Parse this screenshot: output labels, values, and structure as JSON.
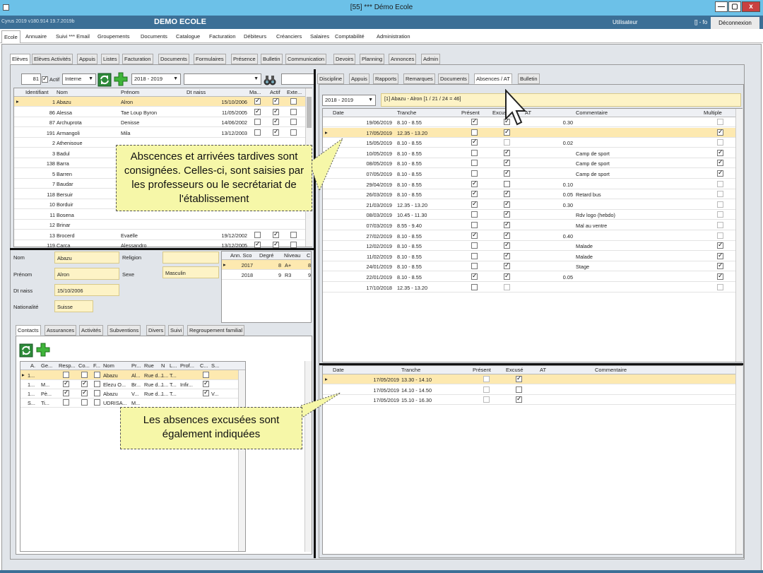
{
  "window": {
    "title": "[55] *** Démo Ecole",
    "minimize": "—",
    "maximize": "▢",
    "close": "x"
  },
  "appbar": {
    "version": "Cyrus 2019 v180.914 19.7.2019b",
    "school": "DEMO ECOLE",
    "user": "Utilisateur",
    "user_extra": "[] - fo",
    "logout": "Déconnexion"
  },
  "menu": [
    "Ecole",
    "Annuaire",
    "Suivi *** Email",
    "Groupements",
    "Documents",
    "Catalogue",
    "Facturation",
    "Débiteurs",
    "Créanciers",
    "Salaires",
    "Comptabilité",
    "Administration"
  ],
  "subtabs": [
    "Elèves",
    "Elèves Activités",
    "Appuis",
    "Listes",
    "Facturation",
    "Documents",
    "Formulaires",
    "Présence",
    "Bulletin",
    "Communication",
    "Devoirs",
    "Planning",
    "Annonces",
    "Admin"
  ],
  "filter": {
    "count": "81",
    "actif_label": "Actif",
    "type": "Interne",
    "year": "2018 - 2019"
  },
  "students": {
    "columns": [
      "Identifiant",
      "Nom",
      "Prénom",
      "Dt naiss",
      "Ma...",
      "Actif",
      "Exte..."
    ],
    "rows": [
      {
        "id": "1",
        "nom": "Abazu",
        "prenom": "Alron",
        "dt": "15/10/2006",
        "ma": true,
        "actif": true,
        "ext": false
      },
      {
        "id": "86",
        "nom": "Alessa",
        "prenom": "Tae Loup Byron",
        "dt": "11/05/2005",
        "ma": true,
        "actif": true,
        "ext": false
      },
      {
        "id": "87",
        "nom": "Archuprota",
        "prenom": "Denisse",
        "dt": "14/06/2002",
        "ma": false,
        "actif": true,
        "ext": false
      },
      {
        "id": "191",
        "nom": "Armangoli",
        "prenom": "Mila",
        "dt": "13/12/2003",
        "ma": false,
        "actif": true,
        "ext": false
      },
      {
        "id": "2",
        "nom": "Athenisoue",
        "prenom": "",
        "dt": "",
        "ma": false,
        "actif": false,
        "ext": false
      },
      {
        "id": "3",
        "nom": "Badul",
        "prenom": "",
        "dt": "",
        "ma": false,
        "actif": false,
        "ext": false
      },
      {
        "id": "138",
        "nom": "Barra",
        "prenom": "",
        "dt": "",
        "ma": false,
        "actif": false,
        "ext": false
      },
      {
        "id": "5",
        "nom": "Barren",
        "prenom": "",
        "dt": "",
        "ma": false,
        "actif": false,
        "ext": false
      },
      {
        "id": "7",
        "nom": "Baudar",
        "prenom": "",
        "dt": "",
        "ma": false,
        "actif": false,
        "ext": false
      },
      {
        "id": "118",
        "nom": "Bersuir",
        "prenom": "",
        "dt": "",
        "ma": false,
        "actif": false,
        "ext": false
      },
      {
        "id": "10",
        "nom": "Borduir",
        "prenom": "",
        "dt": "",
        "ma": false,
        "actif": false,
        "ext": false
      },
      {
        "id": "11",
        "nom": "Bosena",
        "prenom": "",
        "dt": "",
        "ma": false,
        "actif": false,
        "ext": false
      },
      {
        "id": "12",
        "nom": "Brinar",
        "prenom": "",
        "dt": "",
        "ma": false,
        "actif": false,
        "ext": false
      },
      {
        "id": "13",
        "nom": "Brocerd",
        "prenom": "Evaëlle",
        "dt": "19/12/2002",
        "ma": false,
        "actif": true,
        "ext": false
      },
      {
        "id": "119",
        "nom": "Carca",
        "prenom": "Alessandro",
        "dt": "13/12/2005",
        "ma": true,
        "actif": true,
        "ext": false
      }
    ]
  },
  "detail": {
    "nom_label": "Nom",
    "nom": "Abazu",
    "religion_label": "Religion",
    "prenom_label": "Prénom",
    "prenom": "Alron",
    "sexe_label": "Sexe",
    "sexe": "Masculin",
    "dtnaiss_label": "Dt naiss",
    "dtnaiss": "15/10/2006",
    "nat_label": "Nationalité",
    "nat": "Suisse",
    "years_columns": [
      "Ann. Sco",
      "Degré",
      "Niveau",
      "C"
    ],
    "years": [
      {
        "an": "2017",
        "deg": "8",
        "niv": "A+",
        "c": "8"
      },
      {
        "an": "2018",
        "deg": "9",
        "niv": "R3",
        "c": "9"
      }
    ]
  },
  "contact_tabs": [
    "Contacts",
    "Assurances",
    "Activités",
    "Subventions",
    "Divers",
    "Suivi",
    "Regroupement familial"
  ],
  "contacts": {
    "columns": [
      "A.",
      "Ge...",
      "Resp...",
      "Co...",
      "F...",
      "Nom",
      "Pr...",
      "Rue",
      "N",
      "L...",
      "Prof...",
      "C...",
      "S..."
    ],
    "rows": [
      {
        "a": "1...",
        "ge": "",
        "resp": false,
        "co": false,
        "f": false,
        "nom": "Abazu",
        "pr": "Al...",
        "rue": "Rue d...",
        "n": "1...",
        "l": "T...",
        "prof": "",
        "c": false,
        "s": ""
      },
      {
        "a": "1...",
        "ge": "M...",
        "resp": true,
        "co": true,
        "f": false,
        "nom": "Elezu O...",
        "pr": "Br...",
        "rue": "Rue d...",
        "n": "1...",
        "l": "T...",
        "prof": "Infir...",
        "c": true,
        "s": ""
      },
      {
        "a": "1...",
        "ge": "Pè...",
        "resp": true,
        "co": true,
        "f": false,
        "nom": "Abazu",
        "pr": "V...",
        "rue": "Rue d...",
        "n": "1...",
        "l": "T...",
        "prof": "",
        "c": true,
        "s": "V..."
      },
      {
        "a": "S...",
        "ge": "Ti...",
        "resp": false,
        "co": false,
        "f": false,
        "nom": "UDRISA...",
        "pr": "M...",
        "rue": "",
        "n": "",
        "l": "",
        "prof": "",
        "c": false,
        "s": ""
      }
    ]
  },
  "right_tabs": [
    "Discipline",
    "Appuis",
    "Rapports",
    "Remarques",
    "Documents",
    "Absences / AT",
    "Bulletin"
  ],
  "absences": {
    "year": "2018 - 2019",
    "summary": "[1] Abazu - Alron [1 / 21 / 24 = 46]",
    "columns": [
      "Date",
      "Tranche",
      "Présent",
      "Excusé",
      "AT",
      "Commentaire",
      "Multiple"
    ],
    "rows": [
      {
        "date": "19/06/2019",
        "tranche": "8.10 - 8.55",
        "present": true,
        "excuse": true,
        "at": "0.30",
        "comment": "",
        "multiple": false
      },
      {
        "date": "17/05/2019",
        "tranche": "12.35 - 13.20",
        "present": false,
        "excuse": true,
        "at": "",
        "comment": "",
        "multiple": true
      },
      {
        "date": "15/05/2019",
        "tranche": "8.10 - 8.55",
        "present": true,
        "excuse": false,
        "at": "0.02",
        "comment": "",
        "multiple": false
      },
      {
        "date": "10/05/2019",
        "tranche": "8.10 - 8.55",
        "present": false,
        "excuse": true,
        "at": "",
        "comment": "Camp de sport",
        "multiple": true
      },
      {
        "date": "08/05/2019",
        "tranche": "8.10 - 8.55",
        "present": false,
        "excuse": true,
        "at": "",
        "comment": "Camp de sport",
        "multiple": true
      },
      {
        "date": "07/05/2019",
        "tranche": "8.10 - 8.55",
        "present": false,
        "excuse": true,
        "at": "",
        "comment": "Camp de sport",
        "multiple": true
      },
      {
        "date": "29/04/2019",
        "tranche": "8.10 - 8.55",
        "present": true,
        "excuse": false,
        "at": "0.10",
        "comment": "",
        "multiple": false
      },
      {
        "date": "26/03/2019",
        "tranche": "8.10 - 8.55",
        "present": true,
        "excuse": true,
        "at": "0.05",
        "comment": "Retard bus",
        "multiple": false
      },
      {
        "date": "21/03/2019",
        "tranche": "12.35 - 13.20",
        "present": true,
        "excuse": true,
        "at": "0.30",
        "comment": "",
        "multiple": false
      },
      {
        "date": "08/03/2019",
        "tranche": "10.45 - 11.30",
        "present": false,
        "excuse": true,
        "at": "",
        "comment": "Rdv logo (hebdo)",
        "multiple": false
      },
      {
        "date": "07/03/2019",
        "tranche": "8.55 - 9.40",
        "present": false,
        "excuse": true,
        "at": "",
        "comment": "Mal au ventre",
        "multiple": false
      },
      {
        "date": "27/02/2019",
        "tranche": "8.10 - 8.55",
        "present": true,
        "excuse": true,
        "at": "0.40",
        "comment": "",
        "multiple": false
      },
      {
        "date": "12/02/2019",
        "tranche": "8.10 - 8.55",
        "present": false,
        "excuse": true,
        "at": "",
        "comment": "Malade",
        "multiple": true
      },
      {
        "date": "11/02/2019",
        "tranche": "8.10 - 8.55",
        "present": false,
        "excuse": true,
        "at": "",
        "comment": "Malade",
        "multiple": true
      },
      {
        "date": "24/01/2019",
        "tranche": "8.10 - 8.55",
        "present": false,
        "excuse": true,
        "at": "",
        "comment": "Stage",
        "multiple": true
      },
      {
        "date": "22/01/2019",
        "tranche": "8.10 - 8.55",
        "present": true,
        "excuse": true,
        "at": "0.05",
        "comment": "",
        "multiple": true
      },
      {
        "date": "17/10/2018",
        "tranche": "12.35 - 13.20",
        "present": false,
        "excuse": false,
        "at": "",
        "comment": "",
        "multiple": false
      }
    ]
  },
  "absence_detail": {
    "columns": [
      "Date",
      "Tranche",
      "Présent",
      "Excusé",
      "AT",
      "Commentaire"
    ],
    "rows": [
      {
        "date": "17/05/2019",
        "tranche": "13.30 - 14.10",
        "present": false,
        "excuse": true
      },
      {
        "date": "17/05/2019",
        "tranche": "14.10 - 14.50",
        "present": false,
        "excuse": false
      },
      {
        "date": "17/05/2019",
        "tranche": "15.10 - 16.30",
        "present": false,
        "excuse": true
      }
    ]
  },
  "callouts": {
    "first": "Abscences et arrivées tardives sont consignées. Celles-ci, sont saisies par les professeurs ou le secrétariat de l'établissement",
    "second": "Les absences excusées sont également indiquées"
  },
  "colors": {
    "titlebar": "#6cc1e8",
    "appbar": "#3c6f96",
    "selection": "#fde9b0",
    "callout": "#f6f7a8"
  }
}
